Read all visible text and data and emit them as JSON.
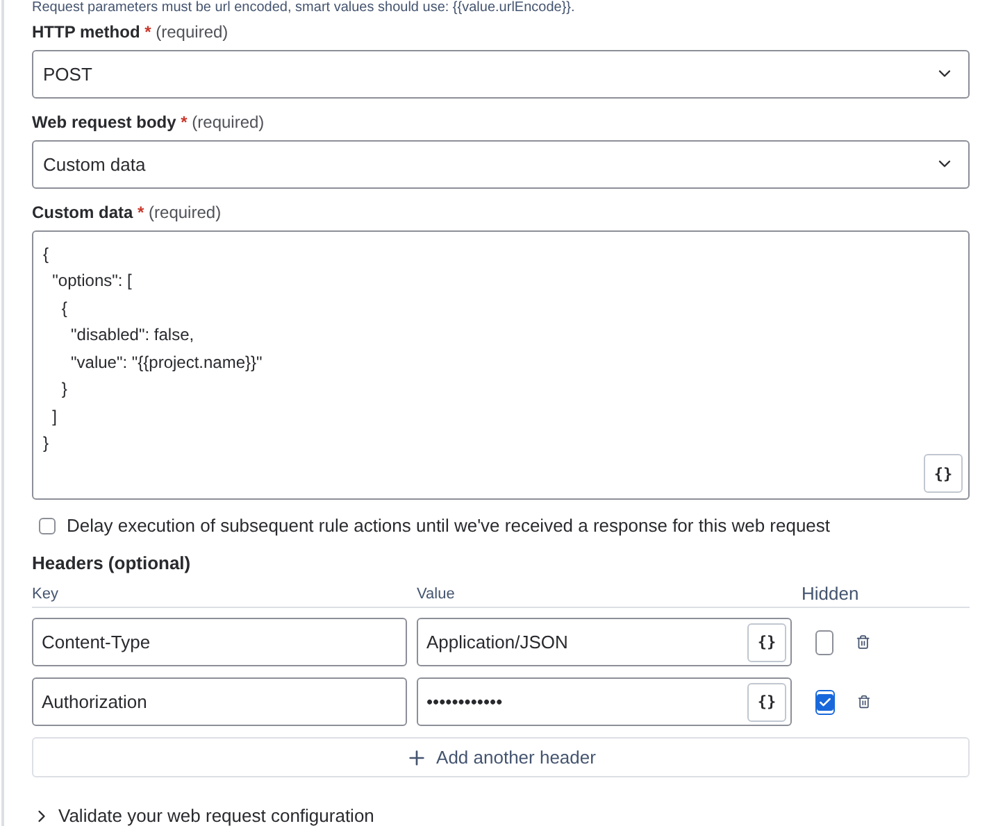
{
  "note": "Request parameters must be url encoded, smart values should use: {{value.urlEncode}}.",
  "fields": [
    {
      "kind": "select",
      "label": "HTTP method",
      "required_mark": "*",
      "required_text": "(required)",
      "value": "POST"
    },
    {
      "kind": "select",
      "label": "Web request body",
      "required_mark": "*",
      "required_text": "(required)",
      "value": "Custom data"
    },
    {
      "kind": "code",
      "label": "Custom data",
      "required_mark": "*",
      "required_text": "(required)",
      "value": "{\n  \"options\": [\n    {\n      \"disabled\": false,\n      \"value\": \"{{project.name}}\"\n    }\n  ]\n}",
      "button": "{}"
    }
  ],
  "delay": {
    "label": "Delay execution of subsequent rule actions until we've received a response for this web request",
    "checked": false
  },
  "headers": {
    "title": "Headers (optional)",
    "columns": [
      "Key",
      "Value",
      "Hidden"
    ],
    "rows": [
      {
        "key": "Content-Type",
        "value": "Application/JSON",
        "button": "{}",
        "hidden": false
      },
      {
        "key": "Authorization",
        "value": "••••••••••••",
        "button": "{}",
        "hidden": true
      }
    ],
    "add_button": "Add another header"
  },
  "validate": {
    "label": "Validate your web request configuration",
    "expanded": false
  }
}
